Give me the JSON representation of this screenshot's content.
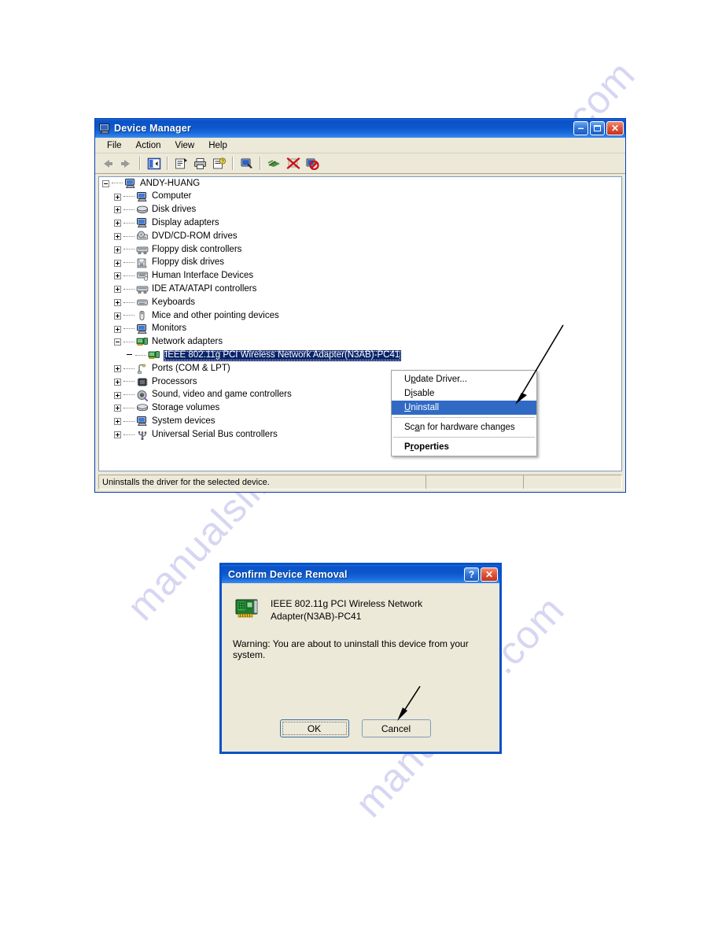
{
  "watermark": {
    "text": "manualslib.com"
  },
  "device_manager": {
    "title": "Device Manager",
    "titlebar_icon": "computer-monitor-icon",
    "window_buttons": {
      "minimize": "–",
      "maximize": "□",
      "close": "✕"
    },
    "menubar": [
      {
        "label": "File"
      },
      {
        "label": "Action"
      },
      {
        "label": "View"
      },
      {
        "label": "Help"
      }
    ],
    "toolbar": [
      {
        "name": "back-icon"
      },
      {
        "name": "forward-icon"
      },
      {
        "name": "separator"
      },
      {
        "name": "show-hide-console-tree-icon"
      },
      {
        "name": "separator"
      },
      {
        "name": "properties-icon"
      },
      {
        "name": "print-icon"
      },
      {
        "name": "help-icon"
      },
      {
        "name": "separator"
      },
      {
        "name": "update-driver-icon"
      },
      {
        "name": "separator"
      },
      {
        "name": "scan-for-hardware-changes-icon"
      },
      {
        "name": "disable-device-icon"
      },
      {
        "name": "uninstall-device-icon"
      }
    ],
    "tree": [
      {
        "label": "ANDY-HUANG",
        "level": 0,
        "expander": "minus",
        "icon": "computer-icon",
        "selected": false
      },
      {
        "label": "Computer",
        "level": 1,
        "expander": "plus",
        "icon": "computer-icon",
        "selected": false
      },
      {
        "label": "Disk drives",
        "level": 1,
        "expander": "plus",
        "icon": "disk-drive-icon",
        "selected": false
      },
      {
        "label": "Display adapters",
        "level": 1,
        "expander": "plus",
        "icon": "display-adapter-icon",
        "selected": false
      },
      {
        "label": "DVD/CD-ROM drives",
        "level": 1,
        "expander": "plus",
        "icon": "dvd-drive-icon",
        "selected": false
      },
      {
        "label": "Floppy disk controllers",
        "level": 1,
        "expander": "plus",
        "icon": "controller-icon",
        "selected": false
      },
      {
        "label": "Floppy disk drives",
        "level": 1,
        "expander": "plus",
        "icon": "floppy-drive-icon",
        "selected": false
      },
      {
        "label": "Human Interface Devices",
        "level": 1,
        "expander": "plus",
        "icon": "hid-icon",
        "selected": false
      },
      {
        "label": "IDE ATA/ATAPI controllers",
        "level": 1,
        "expander": "plus",
        "icon": "controller-icon",
        "selected": false
      },
      {
        "label": "Keyboards",
        "level": 1,
        "expander": "plus",
        "icon": "keyboard-icon",
        "selected": false
      },
      {
        "label": "Mice and other pointing devices",
        "level": 1,
        "expander": "plus",
        "icon": "mouse-icon",
        "selected": false
      },
      {
        "label": "Monitors",
        "level": 1,
        "expander": "plus",
        "icon": "monitor-icon",
        "selected": false
      },
      {
        "label": "Network adapters",
        "level": 1,
        "expander": "minus",
        "icon": "network-adapter-icon",
        "selected": false
      },
      {
        "label": "IEEE 802.11g PCI Wireless Network Adapter(N3AB)-PC41",
        "level": 2,
        "expander": "none",
        "icon": "network-adapter-icon",
        "selected": true
      },
      {
        "label": "Ports (COM & LPT)",
        "level": 1,
        "expander": "plus",
        "icon": "port-icon",
        "selected": false
      },
      {
        "label": "Processors",
        "level": 1,
        "expander": "plus",
        "icon": "processor-icon",
        "selected": false
      },
      {
        "label": "Sound, video and game controllers",
        "level": 1,
        "expander": "plus",
        "icon": "sound-icon",
        "selected": false
      },
      {
        "label": "Storage volumes",
        "level": 1,
        "expander": "plus",
        "icon": "storage-volume-icon",
        "selected": false
      },
      {
        "label": "System devices",
        "level": 1,
        "expander": "plus",
        "icon": "system-device-icon",
        "selected": false
      },
      {
        "label": "Universal Serial Bus controllers",
        "level": 1,
        "expander": "plus",
        "icon": "usb-icon",
        "selected": false
      }
    ],
    "context_menu": [
      {
        "label": "Update Driver...",
        "type": "item",
        "selected": false,
        "bold": false,
        "accel": "p"
      },
      {
        "label": "Disable",
        "type": "item",
        "selected": false,
        "bold": false,
        "accel": "i"
      },
      {
        "label": "Uninstall",
        "type": "item",
        "selected": true,
        "bold": false,
        "accel": "U"
      },
      {
        "type": "separator"
      },
      {
        "label": "Scan for hardware changes",
        "type": "item",
        "selected": false,
        "bold": false,
        "accel": "a"
      },
      {
        "type": "separator"
      },
      {
        "label": "Properties",
        "type": "item",
        "selected": false,
        "bold": true,
        "accel": "r"
      }
    ],
    "statusbar": {
      "message": "Uninstalls the driver for the selected device.",
      "pane2": "",
      "pane3": ""
    }
  },
  "confirm_dialog": {
    "title": "Confirm Device Removal",
    "help_button": "?",
    "close_button": "✕",
    "device_icon": "pci-network-card-icon",
    "device_name_line1": "IEEE 802.11g PCI Wireless Network",
    "device_name_line2": "Adapter(N3AB)-PC41",
    "warning": "Warning: You are about to uninstall this device from your system.",
    "ok_label": "OK",
    "cancel_label": "Cancel"
  },
  "annotations": [
    {
      "name": "arrow-to-uninstall"
    },
    {
      "name": "arrow-to-ok-button"
    }
  ],
  "colors": {
    "titlebar_blue": "#0a52c8",
    "selection_blue": "#0a246a",
    "menu_highlight": "#316ac5",
    "window_face": "#ece9d8",
    "watermark": "#d7d6f2"
  }
}
